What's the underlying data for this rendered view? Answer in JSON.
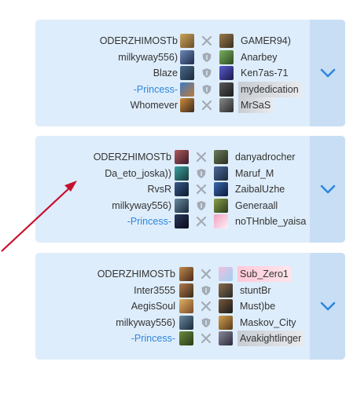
{
  "colors": {
    "card_bg": "#deedfb",
    "expand_bg": "#c8def4",
    "chevron": "#2e86de",
    "accent_name": "#2e86de",
    "arrow": "#c8102e"
  },
  "matches": [
    {
      "left": [
        "ODERZHIMOSTb",
        "milkyway556)",
        "Blaze",
        "-Princess-",
        "Whomever"
      ],
      "right": [
        "GAMER94)",
        "Anarbey",
        "Ken7as-71",
        "mydedication",
        "MrSaS"
      ],
      "mid": [
        "swords-icon",
        "shield-icon",
        "shield-icon",
        "shield-icon",
        "swords-icon"
      ]
    },
    {
      "left": [
        "ODERZHIMOSTb",
        "Da_eto_joska))",
        "RvsR",
        "milkyway556)",
        "-Princess-"
      ],
      "right": [
        "danyadrocher",
        "Maruf_M",
        "ZaibalUzhe",
        "Generaall",
        "noTHnble_yaisa"
      ],
      "mid": [
        "swords-icon",
        "shield-icon",
        "swords-icon",
        "shield-icon",
        "swords-icon"
      ]
    },
    {
      "left": [
        "ODERZHIMOSTb",
        "Inter3555",
        "AegisSoul",
        "milkyway556)",
        "-Princess-"
      ],
      "right": [
        "Sub_Zero1",
        "stuntBr",
        "Must)be",
        "Maskov_City",
        "Avakightlinger"
      ],
      "mid": [
        "swords-icon",
        "shield-icon",
        "swords-icon",
        "shield-icon",
        "swords-icon"
      ]
    }
  ]
}
